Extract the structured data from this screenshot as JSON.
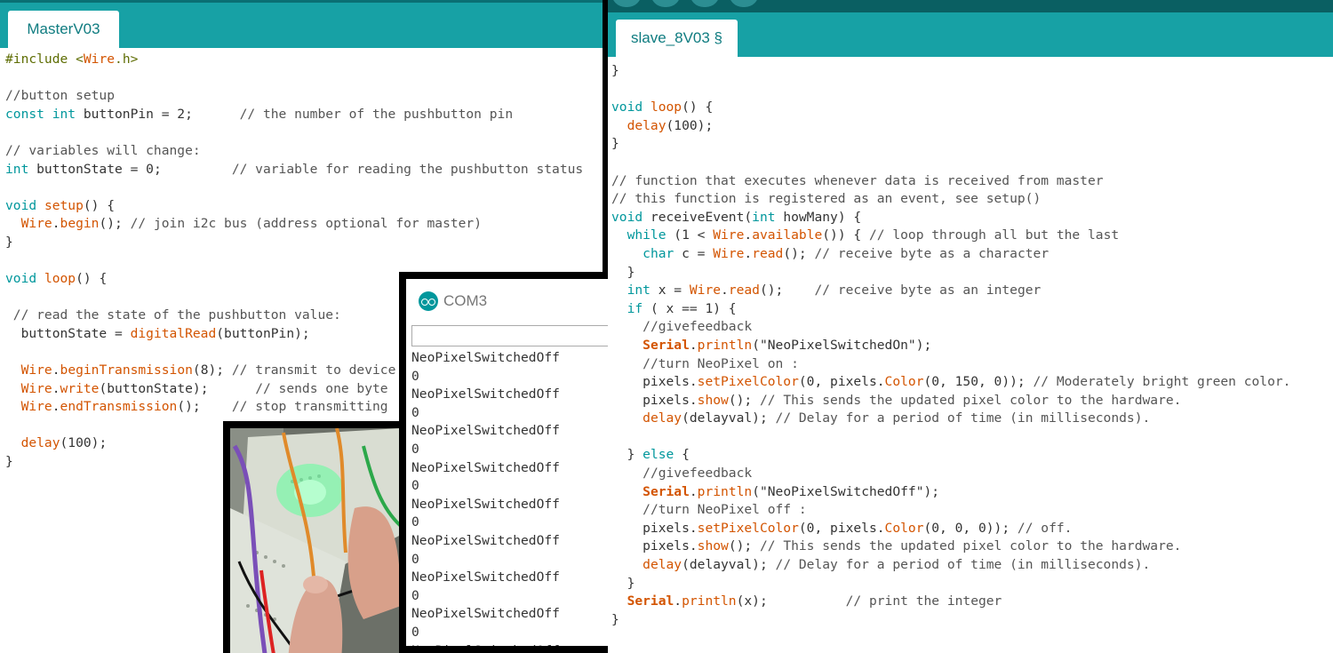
{
  "left_editor": {
    "tab_label": "MasterV03",
    "lines": [
      [
        {
          "t": "#include <",
          "c": "k-inc"
        },
        {
          "t": "Wire",
          "c": "k-fn"
        },
        {
          "t": ".h>",
          "c": "k-inc"
        }
      ],
      [],
      [
        {
          "t": "//button setup",
          "c": "k-cm"
        }
      ],
      [
        {
          "t": "const int",
          "c": "k-type"
        },
        {
          "t": " buttonPin = 2;      "
        },
        {
          "t": "// the number of the pushbutton pin",
          "c": "k-cm"
        }
      ],
      [],
      [
        {
          "t": "// variables will change:",
          "c": "k-cm"
        }
      ],
      [
        {
          "t": "int",
          "c": "k-type"
        },
        {
          "t": " buttonState = 0;         "
        },
        {
          "t": "// variable for reading the pushbutton status",
          "c": "k-cm"
        }
      ],
      [],
      [
        {
          "t": "void",
          "c": "k-type"
        },
        {
          "t": " "
        },
        {
          "t": "setup",
          "c": "k-fn"
        },
        {
          "t": "() {"
        }
      ],
      [
        {
          "t": "  "
        },
        {
          "t": "Wire",
          "c": "k-fn"
        },
        {
          "t": "."
        },
        {
          "t": "begin",
          "c": "k-fn"
        },
        {
          "t": "(); "
        },
        {
          "t": "// join i2c bus (address optional for master)",
          "c": "k-cm"
        }
      ],
      [
        {
          "t": "}"
        }
      ],
      [],
      [
        {
          "t": "void",
          "c": "k-type"
        },
        {
          "t": " "
        },
        {
          "t": "loop",
          "c": "k-fn"
        },
        {
          "t": "() {"
        }
      ],
      [],
      [
        {
          "t": " // read the state of the pushbutton value:",
          "c": "k-cm"
        }
      ],
      [
        {
          "t": "  buttonState = "
        },
        {
          "t": "digitalRead",
          "c": "k-fn"
        },
        {
          "t": "(buttonPin);"
        }
      ],
      [],
      [
        {
          "t": "  "
        },
        {
          "t": "Wire",
          "c": "k-fn"
        },
        {
          "t": "."
        },
        {
          "t": "beginTransmission",
          "c": "k-fn"
        },
        {
          "t": "(8); "
        },
        {
          "t": "// transmit to device",
          "c": "k-cm"
        }
      ],
      [
        {
          "t": "  "
        },
        {
          "t": "Wire",
          "c": "k-fn"
        },
        {
          "t": "."
        },
        {
          "t": "write",
          "c": "k-fn"
        },
        {
          "t": "(buttonState);      "
        },
        {
          "t": "// sends one byte",
          "c": "k-cm"
        }
      ],
      [
        {
          "t": "  "
        },
        {
          "t": "Wire",
          "c": "k-fn"
        },
        {
          "t": "."
        },
        {
          "t": "endTransmission",
          "c": "k-fn"
        },
        {
          "t": "();    "
        },
        {
          "t": "// stop transmitting",
          "c": "k-cm"
        }
      ],
      [],
      [
        {
          "t": "  "
        },
        {
          "t": "delay",
          "c": "k-fn"
        },
        {
          "t": "(100);"
        }
      ],
      [
        {
          "t": "}"
        }
      ]
    ]
  },
  "right_editor": {
    "tab_label": "slave_8V03 §",
    "lines": [
      [
        {
          "t": "}"
        }
      ],
      [],
      [
        {
          "t": "void",
          "c": "k-type"
        },
        {
          "t": " "
        },
        {
          "t": "loop",
          "c": "k-fn"
        },
        {
          "t": "() {"
        }
      ],
      [
        {
          "t": "  "
        },
        {
          "t": "delay",
          "c": "k-fn"
        },
        {
          "t": "(100);"
        }
      ],
      [
        {
          "t": "}"
        }
      ],
      [],
      [
        {
          "t": "// function that executes whenever data is received from master",
          "c": "k-cm"
        }
      ],
      [
        {
          "t": "// this function is registered as an event, see setup()",
          "c": "k-cm"
        }
      ],
      [
        {
          "t": "void",
          "c": "k-type"
        },
        {
          "t": " receiveEvent("
        },
        {
          "t": "int",
          "c": "k-type"
        },
        {
          "t": " howMany) {"
        }
      ],
      [
        {
          "t": "  "
        },
        {
          "t": "while",
          "c": "k-type"
        },
        {
          "t": " (1 < "
        },
        {
          "t": "Wire",
          "c": "k-fn"
        },
        {
          "t": "."
        },
        {
          "t": "available",
          "c": "k-fn"
        },
        {
          "t": "()) { "
        },
        {
          "t": "// loop through all but the last",
          "c": "k-cm"
        }
      ],
      [
        {
          "t": "    "
        },
        {
          "t": "char",
          "c": "k-type"
        },
        {
          "t": " c = "
        },
        {
          "t": "Wire",
          "c": "k-fn"
        },
        {
          "t": "."
        },
        {
          "t": "read",
          "c": "k-fn"
        },
        {
          "t": "(); "
        },
        {
          "t": "// receive byte as a character",
          "c": "k-cm"
        }
      ],
      [
        {
          "t": "  }"
        }
      ],
      [
        {
          "t": "  "
        },
        {
          "t": "int",
          "c": "k-type"
        },
        {
          "t": " x = "
        },
        {
          "t": "Wire",
          "c": "k-fn"
        },
        {
          "t": "."
        },
        {
          "t": "read",
          "c": "k-fn"
        },
        {
          "t": "();    "
        },
        {
          "t": "// receive byte as an integer",
          "c": "k-cm"
        }
      ],
      [
        {
          "t": "  "
        },
        {
          "t": "if",
          "c": "k-type"
        },
        {
          "t": " ( x == 1) {"
        }
      ],
      [
        {
          "t": "    "
        },
        {
          "t": "//givefeedback",
          "c": "k-cm"
        }
      ],
      [
        {
          "t": "    "
        },
        {
          "t": "Serial",
          "c": "k-ser"
        },
        {
          "t": "."
        },
        {
          "t": "println",
          "c": "k-fn"
        },
        {
          "t": "(\"NeoPixelSwitchedOn\");"
        }
      ],
      [
        {
          "t": "    "
        },
        {
          "t": "//turn NeoPixel on :",
          "c": "k-cm"
        }
      ],
      [
        {
          "t": "    pixels."
        },
        {
          "t": "setPixelColor",
          "c": "k-fn"
        },
        {
          "t": "(0, pixels."
        },
        {
          "t": "Color",
          "c": "k-fn"
        },
        {
          "t": "(0, 150, 0)); "
        },
        {
          "t": "// Moderately bright green color.",
          "c": "k-cm"
        }
      ],
      [
        {
          "t": "    pixels."
        },
        {
          "t": "show",
          "c": "k-fn"
        },
        {
          "t": "(); "
        },
        {
          "t": "// This sends the updated pixel color to the hardware.",
          "c": "k-cm"
        }
      ],
      [
        {
          "t": "    "
        },
        {
          "t": "delay",
          "c": "k-fn"
        },
        {
          "t": "(delayval); "
        },
        {
          "t": "// Delay for a period of time (in milliseconds).",
          "c": "k-cm"
        }
      ],
      [],
      [
        {
          "t": "  } "
        },
        {
          "t": "else",
          "c": "k-type"
        },
        {
          "t": " {"
        }
      ],
      [
        {
          "t": "    "
        },
        {
          "t": "//givefeedback",
          "c": "k-cm"
        }
      ],
      [
        {
          "t": "    "
        },
        {
          "t": "Serial",
          "c": "k-ser"
        },
        {
          "t": "."
        },
        {
          "t": "println",
          "c": "k-fn"
        },
        {
          "t": "(\"NeoPixelSwitchedOff\");"
        }
      ],
      [
        {
          "t": "    "
        },
        {
          "t": "//turn NeoPixel off :",
          "c": "k-cm"
        }
      ],
      [
        {
          "t": "    pixels."
        },
        {
          "t": "setPixelColor",
          "c": "k-fn"
        },
        {
          "t": "(0, pixels."
        },
        {
          "t": "Color",
          "c": "k-fn"
        },
        {
          "t": "(0, 0, 0)); "
        },
        {
          "t": "// off.",
          "c": "k-cm"
        }
      ],
      [
        {
          "t": "    pixels."
        },
        {
          "t": "show",
          "c": "k-fn"
        },
        {
          "t": "(); "
        },
        {
          "t": "// This sends the updated pixel color to the hardware.",
          "c": "k-cm"
        }
      ],
      [
        {
          "t": "    "
        },
        {
          "t": "delay",
          "c": "k-fn"
        },
        {
          "t": "(delayval); "
        },
        {
          "t": "// Delay for a period of time (in milliseconds).",
          "c": "k-cm"
        }
      ],
      [
        {
          "t": "  }"
        }
      ],
      [
        {
          "t": "  "
        },
        {
          "t": "Serial",
          "c": "k-ser"
        },
        {
          "t": "."
        },
        {
          "t": "println",
          "c": "k-fn"
        },
        {
          "t": "(x);          "
        },
        {
          "t": "// print the integer",
          "c": "k-cm"
        }
      ],
      [
        {
          "t": "}"
        }
      ]
    ]
  },
  "serial_monitor": {
    "title": "COM3",
    "icon": "arduino-logo-icon",
    "output": [
      "NeoPixelSwitchedOff",
      "0",
      "NeoPixelSwitchedOff",
      "0",
      "NeoPixelSwitchedOff",
      "0",
      "NeoPixelSwitchedOff",
      "0",
      "NeoPixelSwitchedOff",
      "0",
      "NeoPixelSwitchedOff",
      "0",
      "NeoPixelSwitchedOff",
      "0",
      "NeoPixelSwitchedOff",
      "0",
      "NeoPixelSwitchedOff"
    ]
  },
  "colors": {
    "tab_bar": "#17a1a5",
    "keyword": "#00979c",
    "function": "#d35400",
    "comment": "#555555"
  }
}
